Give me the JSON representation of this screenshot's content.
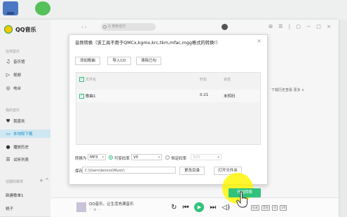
{
  "app": {
    "name": "QQ音乐"
  },
  "sidebar": {
    "section_online": "在线音乐",
    "items_top": [
      {
        "label": "音乐馆",
        "icon": "music-note-icon"
      },
      {
        "label": "视频",
        "icon": "video-icon"
      },
      {
        "label": "电台",
        "icon": "radio-icon"
      }
    ],
    "section_mine": "我的音乐",
    "items_mine": [
      {
        "label": "我喜欢",
        "icon": "heart-icon"
      },
      {
        "label": "本地和下载",
        "icon": "computer-icon",
        "active": true
      },
      {
        "label": "播放历史",
        "icon": "history-icon"
      },
      {
        "label": "试听列表",
        "icon": "playlist-icon"
      }
    ],
    "section_created": "创建的歌单",
    "created_controls": "+ ^",
    "playlists": [
      "新建歌单1",
      "桃子"
    ]
  },
  "topbar": {
    "nav": "‹ ›",
    "search_placeholder": "Q 搜索音乐",
    "window_icons": "⊞ ☰ | ▢ − □ ×"
  },
  "main": {
    "right_actions": "下载历史查看 更多 ∨"
  },
  "dialog": {
    "title": "音频转换（该工具不用于QMCx,kgmx,krc,tkm,mfac,mgg格式的转换!）",
    "close": "×",
    "buttons": {
      "add_song": "添加歌曲",
      "import_cd": "导入CD",
      "clear_list": "清除已勾"
    },
    "columns": {
      "filename": "文件名",
      "duration": "时长",
      "status": "状态"
    },
    "rows": [
      {
        "name": "歌曲1",
        "duration": "0:21",
        "status": "未转码"
      }
    ],
    "convert_label": "转换为",
    "format": "MP3",
    "vbr_label": "可变码率",
    "vbr_value": "V0",
    "cbr_label": "恒定码率",
    "cbr_value": "320",
    "save_label": "保存到",
    "save_path": "C:\\Users\\lenovo\\Music\\",
    "change_dir": "更改目录",
    "open_folder": "打开文件夹",
    "start": "开始转换"
  },
  "player": {
    "title": "QQ音乐，让生活充满音乐",
    "tags": [
      "标准",
      "音效",
      "词",
      "3/0"
    ]
  }
}
